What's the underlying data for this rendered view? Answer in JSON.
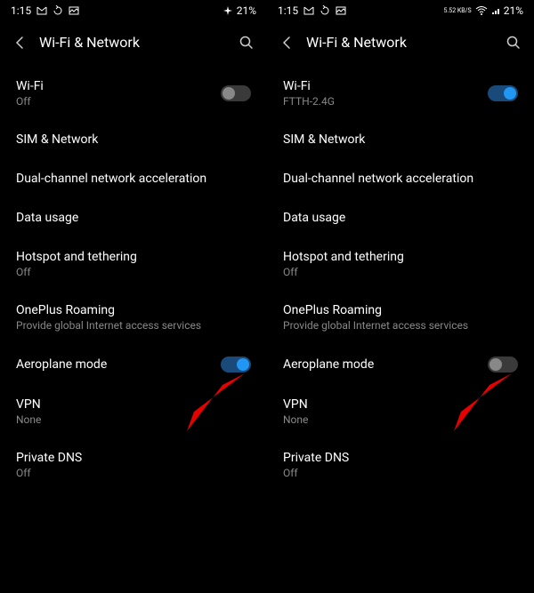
{
  "left": {
    "status": {
      "time": "1:15",
      "battery": "21%"
    },
    "header": {
      "title": "Wi-Fi & Network"
    },
    "rows": {
      "wifi": {
        "title": "Wi-Fi",
        "sub": "Off"
      },
      "sim": {
        "title": "SIM & Network"
      },
      "dualchannel": {
        "title": "Dual-channel network acceleration"
      },
      "datausage": {
        "title": "Data usage"
      },
      "hotspot": {
        "title": "Hotspot and tethering",
        "sub": "Off"
      },
      "roaming": {
        "title": "OnePlus Roaming",
        "sub": "Provide global Internet access services"
      },
      "aeroplane": {
        "title": "Aeroplane mode"
      },
      "vpn": {
        "title": "VPN",
        "sub": "None"
      },
      "pdns": {
        "title": "Private DNS",
        "sub": "Off"
      }
    }
  },
  "right": {
    "status": {
      "time": "1:15",
      "speed": "5.52 KB/S",
      "battery": "21%"
    },
    "header": {
      "title": "Wi-Fi & Network"
    },
    "rows": {
      "wifi": {
        "title": "Wi-Fi",
        "sub": "FTTH-2.4G"
      },
      "sim": {
        "title": "SIM & Network"
      },
      "dualchannel": {
        "title": "Dual-channel network acceleration"
      },
      "datausage": {
        "title": "Data usage"
      },
      "hotspot": {
        "title": "Hotspot and tethering",
        "sub": "Off"
      },
      "roaming": {
        "title": "OnePlus Roaming",
        "sub": "Provide global Internet access services"
      },
      "aeroplane": {
        "title": "Aeroplane mode"
      },
      "vpn": {
        "title": "VPN",
        "sub": "None"
      },
      "pdns": {
        "title": "Private DNS",
        "sub": "Off"
      }
    }
  }
}
